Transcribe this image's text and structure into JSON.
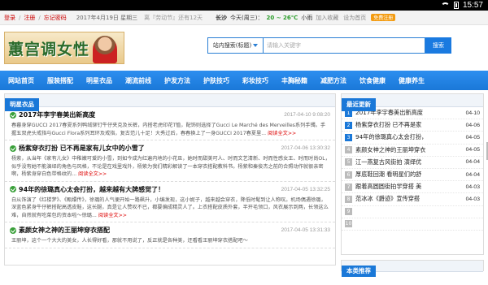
{
  "statusbar": {
    "time": "15:57"
  },
  "topbar": {
    "login": "登录",
    "register": "注册",
    "forgot": "忘记密码",
    "date": "2017年4月19日 星期三",
    "holiday": "离『劳动节』还有12天",
    "city": "长沙",
    "weather_prefix": "今天(周三)：",
    "temp": "20 ~ 26℃",
    "weather_suffix": "小雨",
    "favorite": "加入收藏",
    "homepage": "设为首页",
    "badge": "免费注册"
  },
  "logo": {
    "text": "蕙宫调女性"
  },
  "search": {
    "select_label": "站内搜索(标题)",
    "placeholder": "请输入关键字",
    "button": "搜索"
  },
  "nav": [
    "网站首页",
    "服装搭配",
    "明星衣品",
    "潮流前线",
    "护发方法",
    "护肤技巧",
    "彩妆技巧",
    "丰胸秘籍",
    "减肥方法",
    "饮食健康",
    "健康养生"
  ],
  "left_panel": {
    "title": "明星衣品",
    "read_more": "阅读全文>>",
    "articles": [
      {
        "title": "2017年李宇春美出新高度",
        "date": "2017-04-10 9:08:20",
        "body": "春暮身穿GUCCI 2017春夏系列鸭绒铆钉牛仔夹克及长裤，内搭老虎印花T恤，配饰则选择了Gucci Le Marché des Merveilles系列手镯。手握五双虎头戒指与Gucci Flora系列耳环及戒指，复古范儿十足！大秀过后，春春换上了一身GUCCI 2017春夏里..."
      },
      {
        "title": "杨紫穿衣打扮 已不再是家有儿女中的小雪了",
        "date": "2017-04-06 13:30:32",
        "body": "杨紫，从当年《家有儿女》中稚嫩可爱的小雪，到如今成为红遍内地的小花旦，她时而甜美可人、时而文艺清新、时而性感女王、时而时尚OL，似乎没有她不能演绎的角色与风格，不论是在戏里戏外，杨紫为我们精彩解读了一本穿衣搭配教科书。杨紫和秦俊杰之前的合照动作就很亲密啊，杨紫身穿白色带格纹的..."
      },
      {
        "title": "94年的徐璐真心太会打扮，越来越有大牌感觉了！",
        "date": "2017-04-05 13:32:25",
        "body": "白从饰演了《红楼梦》、《甄嬛传》，徐璐的人气便开始一路飙升，小编发现，这小妮子，越来越会穿衣，降低时髦到让人称叹。机场偶遇徐璐，深蓝色紧身牛仔裤搭配高透皮鞋，这长腿，真是让人赞叹不已，都要偏成精灵人了。上衣搭配皮质外套，半开毛领口，风衣展示到两，长领这么难，自然就有吃菜包的资本啦～徐璐..."
      },
      {
        "title": "素颜女神之神的王丽坤穿衣搭配",
        "date": "2017-04-05 13:31:33",
        "body": "王丽坤，这个一个大大的美女，人长得好看，那就不用说了，反正就是各种美，还看看王丽坤穿衣搭配吧～"
      }
    ]
  },
  "right_panel": {
    "title": "最近更新",
    "items": [
      {
        "num": "1",
        "title": "2017年李宇春美出新高度",
        "date": "04-10"
      },
      {
        "num": "2",
        "title": "杨紫穿衣打扮 已不再是家",
        "date": "04-06"
      },
      {
        "num": "3",
        "title": "94年的徐璐真心太会打扮，",
        "date": "04-05"
      },
      {
        "num": "4",
        "title": "素颜女神之神的王丽坤穿衣",
        "date": "04-05"
      },
      {
        "num": "5",
        "title": "江一燕复古风街拍 演绎优",
        "date": "04-04"
      },
      {
        "num": "6",
        "title": "厚底鞋回潮 看明星们的舒",
        "date": "04-04"
      },
      {
        "num": "7",
        "title": "跟着高圆圆街拍学穿搭 美",
        "date": "04-03"
      },
      {
        "num": "8",
        "title": "范冰冰《爵迹》宣传穿搭",
        "date": "04-03"
      },
      {
        "num": "9",
        "title": "",
        "date": ""
      },
      {
        "num": "10",
        "title": "",
        "date": ""
      }
    ]
  },
  "recommend": {
    "title": "本类推荐"
  }
}
